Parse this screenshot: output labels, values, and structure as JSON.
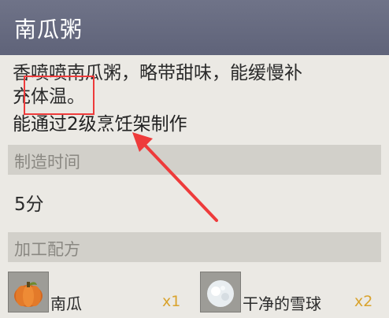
{
  "header": {
    "title": "南瓜粥"
  },
  "description": {
    "line1": "香喷喷南瓜粥，略带甜味，能缓慢补",
    "line2": "充体温。",
    "craft": "能通过2级烹饪架制作"
  },
  "sections": {
    "time_label": "制造时间",
    "time_value": "5分",
    "recipe_label": "加工配方"
  },
  "ingredients": [
    {
      "name": "南瓜",
      "qty": "x1",
      "icon": "pumpkin-icon"
    },
    {
      "name": "干净的雪球",
      "qty": "x2",
      "icon": "snowball-icon"
    }
  ],
  "colors": {
    "header_bg": "#656a80",
    "panel_bg": "#ebe9e4",
    "section_bg": "#d2d0ca",
    "qty_color": "#d9a32d",
    "annotation_red": "#ee3b3b"
  }
}
